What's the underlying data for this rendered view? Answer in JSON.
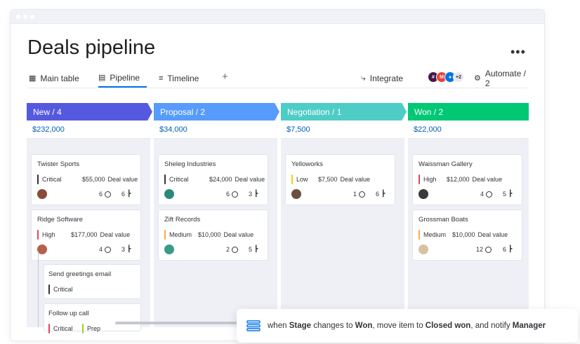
{
  "page": {
    "title": "Deals pipeline",
    "more": "•••"
  },
  "views": {
    "tabs": [
      {
        "label": "Main table",
        "icon": "table-icon"
      },
      {
        "label": "Pipeline",
        "icon": "kanban-icon",
        "active": true
      },
      {
        "label": "Timeline",
        "icon": "timeline-icon"
      }
    ],
    "add": "+",
    "integrate": "Integrate",
    "integrations_more": "+2",
    "automate": "Automate / 2"
  },
  "colors": {
    "new": "#5559df",
    "proposal": "#579bfc",
    "negotiation": "#4eccc6",
    "won": "#00c875",
    "critical": "#333333",
    "high": "#e2445c",
    "medium": "#fdab3d",
    "low": "#ffcb00",
    "prep": "#9cd326"
  },
  "columns": [
    {
      "name": "New / 4",
      "total": "$232,000",
      "cards": [
        {
          "title": "Twister Sports",
          "priority": "Critical",
          "deal": "$55,000",
          "deal_label": "Deal value",
          "comments": "6",
          "subitems": "6"
        },
        {
          "title": "Ridge Software",
          "priority": "High",
          "deal": "$177,000",
          "deal_label": "Deal value",
          "comments": "4",
          "subitems": "3"
        }
      ],
      "subitems": [
        {
          "title": "Send greetings email",
          "tags": [
            "Critical"
          ]
        },
        {
          "title": "Follow up call",
          "tags": [
            "Critical",
            "Prep"
          ]
        }
      ]
    },
    {
      "name": "Proposal / 2",
      "total": "$34,000",
      "cards": [
        {
          "title": "Sheleg Industries",
          "priority": "Critical",
          "deal": "$24,000",
          "deal_label": "Deal value",
          "comments": "6",
          "subitems": "3"
        },
        {
          "title": "Zift Records",
          "priority": "Medium",
          "deal": "$10,000",
          "deal_label": "Deal value",
          "comments": "2",
          "subitems": "5"
        }
      ]
    },
    {
      "name": "Negotiation / 1",
      "total": "$7,500",
      "cards": [
        {
          "title": "Yelloworks",
          "priority": "Low",
          "deal": "$7,500",
          "deal_label": "Deal value",
          "comments": "1",
          "subitems": "6"
        }
      ]
    },
    {
      "name": "Won / 2",
      "total": "$22,000",
      "cards": [
        {
          "title": "Waissman Gallery",
          "priority": "High",
          "deal": "$12,000",
          "deal_label": "Deal value",
          "comments": "4",
          "subitems": "5"
        },
        {
          "title": "Grossman Boats",
          "priority": "Medium",
          "deal": "$10,000",
          "deal_label": "Deal value",
          "comments": "12",
          "subitems": "6"
        }
      ]
    }
  ],
  "automation": {
    "p1": "when ",
    "k1": "Stage",
    "p2": " changes to ",
    "k2": "Won",
    "p3": ", move item to ",
    "k3": "Closed won",
    "p4": ", and notify ",
    "k4": "Manager"
  }
}
